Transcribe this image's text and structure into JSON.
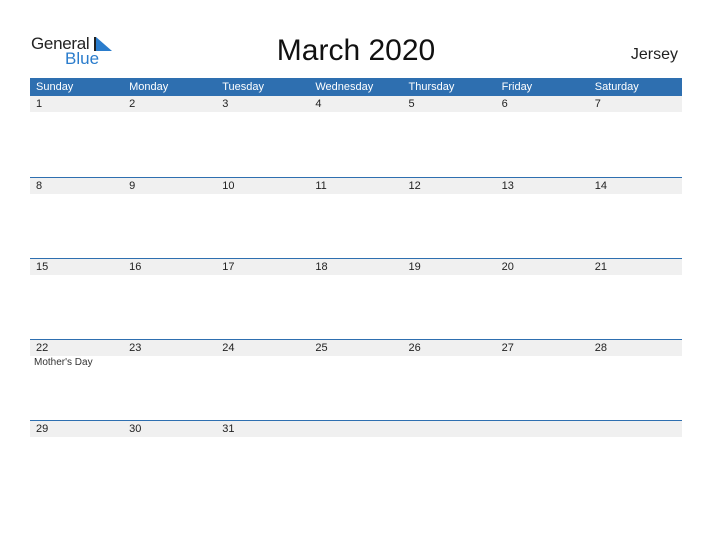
{
  "logo": {
    "word1": "General",
    "word2": "Blue"
  },
  "title": "March 2020",
  "country": "Jersey",
  "weekdays": [
    "Sunday",
    "Monday",
    "Tuesday",
    "Wednesday",
    "Thursday",
    "Friday",
    "Saturday"
  ],
  "weeks": [
    {
      "days": [
        "1",
        "2",
        "3",
        "4",
        "5",
        "6",
        "7"
      ],
      "events": [
        "",
        "",
        "",
        "",
        "",
        "",
        ""
      ]
    },
    {
      "days": [
        "8",
        "9",
        "10",
        "11",
        "12",
        "13",
        "14"
      ],
      "events": [
        "",
        "",
        "",
        "",
        "",
        "",
        ""
      ]
    },
    {
      "days": [
        "15",
        "16",
        "17",
        "18",
        "19",
        "20",
        "21"
      ],
      "events": [
        "",
        "",
        "",
        "",
        "",
        "",
        ""
      ]
    },
    {
      "days": [
        "22",
        "23",
        "24",
        "25",
        "26",
        "27",
        "28"
      ],
      "events": [
        "Mother's Day",
        "",
        "",
        "",
        "",
        "",
        ""
      ]
    },
    {
      "days": [
        "29",
        "30",
        "31",
        "",
        "",
        "",
        ""
      ],
      "events": [
        "",
        "",
        "",
        "",
        "",
        "",
        ""
      ]
    }
  ],
  "colors": {
    "header": "#2e6fb0",
    "accent": "#2a7ccc",
    "row_bg": "#f0f0f0"
  }
}
